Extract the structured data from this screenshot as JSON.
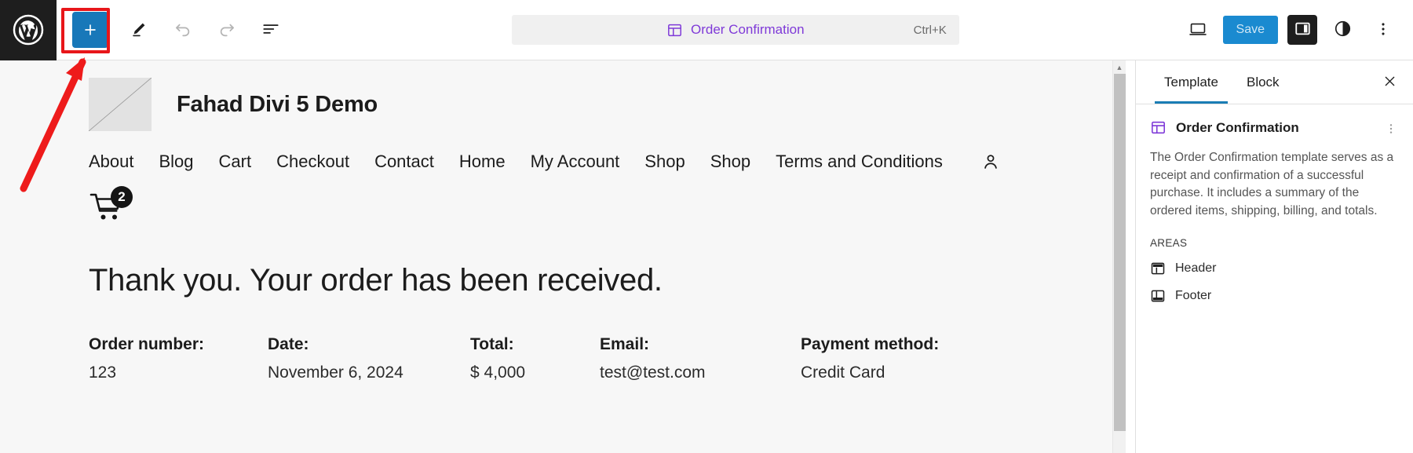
{
  "toolbar": {
    "wp_logo_title": "WordPress",
    "add_block_label": "+",
    "edit_tool_name": "edit-pencil",
    "undo_name": "undo",
    "redo_name": "redo",
    "list_view_name": "document-overview",
    "command_bar": {
      "icon": "template-icon",
      "title": "Order Confirmation",
      "shortcut": "Ctrl+K"
    },
    "view_icon": "desktop-view",
    "save_label": "Save",
    "sidebar_toggle_name": "settings-panel-toggle",
    "styles_name": "styles-contrast",
    "options_name": "more-options"
  },
  "canvas": {
    "site": {
      "logo_alt": "site-logo-placeholder",
      "title": "Fahad Divi 5 Demo"
    },
    "nav": [
      "About",
      "Blog",
      "Cart",
      "Checkout",
      "Contact",
      "Home",
      "My Account",
      "Shop",
      "Shop",
      "Terms and Conditions"
    ],
    "account_icon": "account-icon",
    "cart": {
      "icon": "cart-icon",
      "count": "2"
    },
    "heading": "Thank you. Your order has been received.",
    "order_details": [
      {
        "label": "Order number:",
        "value": "123"
      },
      {
        "label": "Date:",
        "value": "November 6, 2024"
      },
      {
        "label": "Total:",
        "value": "$ 4,000"
      },
      {
        "label": "Email:",
        "value": "test@test.com"
      },
      {
        "label": "Payment method:",
        "value": "Credit Card"
      }
    ]
  },
  "sidebar": {
    "tabs": [
      {
        "label": "Template",
        "active": true
      },
      {
        "label": "Block",
        "active": false
      }
    ],
    "close_label": "Close settings",
    "template": {
      "name": "Order Confirmation",
      "description": "The Order Confirmation template serves as a receipt and confirmation of a successful purchase. It includes a summary of the ordered items, shipping, billing, and totals."
    },
    "areas_label": "AREAS",
    "areas": [
      {
        "label": "Header",
        "icon": "header-area-icon"
      },
      {
        "label": "Footer",
        "icon": "footer-area-icon"
      }
    ]
  },
  "annotation": {
    "arrow_color": "#ee1b1b",
    "highlight_color": "#e8161a",
    "target": "add-block-button"
  },
  "colors": {
    "accent_blue": "#1878b9",
    "save_blue": "#1a8ad0",
    "purple": "#7f3ad8",
    "canvas_bg": "#f7f7f7",
    "dark": "#1e1e1e"
  }
}
